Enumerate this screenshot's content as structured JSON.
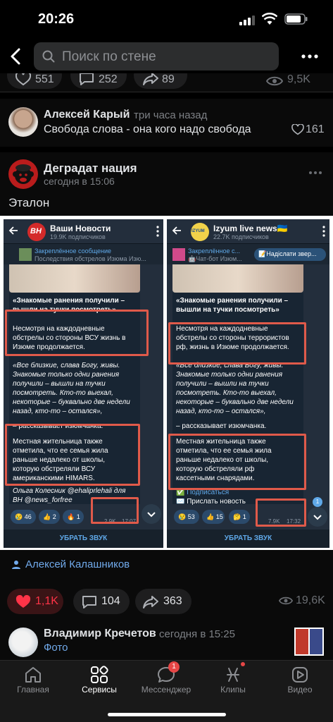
{
  "status_bar": {
    "time": "20:26"
  },
  "search": {
    "placeholder": "Поиск по стене"
  },
  "previous_post": {
    "likes": "551",
    "comments": "252",
    "reposts": "89",
    "views": "9,5K"
  },
  "top_comment": {
    "author": "Алексей Карый",
    "time": "три часа назад",
    "text": "Свобода слова - она кого надо свобода",
    "likes": "161"
  },
  "post": {
    "author": "Деградат нация",
    "time": "сегодня в 15:06",
    "text": "Эталон",
    "signer": "Алексей Калашников",
    "likes": "1,1K",
    "comments": "104",
    "reposts": "363",
    "views": "19,6K"
  },
  "left_screenshot": {
    "channel": "Ваши Новости",
    "subscribers": "19.9K подписчиков",
    "avatar_text": "ВН",
    "pinned_title": "Закреплённое сообщение",
    "pinned_sub": "Последствия обстрелов Изюма  Изю...",
    "lines": [
      "«Знакомые ранения получили –",
      "вышли на тучки посмотреть»",
      "Несмотря на каждодневные",
      "обстрелы со стороны ВСУ жизнь в",
      "Изюме продолжается.",
      "«Все близкие, слава Богу, живы.",
      "Знакомые только одни ранения",
      "получили – вышли на тучки",
      "посмотреть. Кто-то выехал,",
      "некоторые – буквально две недели",
      "назад, кто-то – остался»,",
      "– рассказывает изюмчанка.",
      "Местная жительница также",
      "отметила, что ее семья жила",
      "раньше недалеко от школы,",
      "которую обстреляли ВСУ",
      "американскими HIMARS.",
      "Ольга Колесник @ehaliprlehali для",
      "ВН @news_forfree"
    ],
    "reactions": [
      "😢 46",
      "👍 2",
      "🔥 1"
    ],
    "views": "2.9K",
    "time": "17:07",
    "footer": "УБРАТЬ ЗВУК"
  },
  "right_screenshot": {
    "channel": "Izyum live news🇺🇦",
    "subscribers": "22.7K подписчиков",
    "avatar_text": "IZYUM",
    "pinned_title": "Закреплённое с...",
    "pinned_sub": "🤖Чат-бот Изюм...",
    "pinned_button": "📝Надіслати звер...",
    "lines": [
      "«Знакомые ранения получили –",
      "вышли на тучки посмотреть»",
      "Несмотря на каждодневные",
      "обстрелы со стороны террористов",
      "рф, жизнь в Изюме продолжается.",
      "«Все близкие, слава Богу, живы.",
      "Знакомые только одни ранения",
      "получили – вышли на тучки",
      "посмотреть. Кто-то выехал,",
      "некоторые – буквально две недели",
      "назад, кто-то – остался»,",
      "– рассказывает изюмчанка.",
      "Местная жительница также",
      "отметила, что ее семья жила",
      "раньше недалеко от школы,",
      "которую обстреляли рф",
      "кассетными снарядами.",
      "✅ Подписаться",
      "✉️ Прислать новость"
    ],
    "reactions": [
      "😢 53",
      "👍 15",
      "🤔 1"
    ],
    "views": "7.9K",
    "time": "17:32",
    "badge": "1",
    "footer": "УБРАТЬ ЗВУК"
  },
  "next_comment": {
    "author": "Владимир Кречетов",
    "time": "сегодня в 15:25",
    "text": "Фото"
  },
  "tabbar": {
    "items": [
      {
        "label": "Главная",
        "icon": "home-icon"
      },
      {
        "label": "Сервисы",
        "icon": "services-icon"
      },
      {
        "label": "Мессенджер",
        "icon": "messenger-icon",
        "badge": "1"
      },
      {
        "label": "Клипы",
        "icon": "clips-icon"
      },
      {
        "label": "Видео",
        "icon": "video-icon"
      }
    ],
    "active": "Сервисы"
  },
  "colors": {
    "accent": "#71aaeb",
    "like": "#ff3347",
    "highlight_box": "#e05a4a",
    "background": "#0a0a0a"
  }
}
